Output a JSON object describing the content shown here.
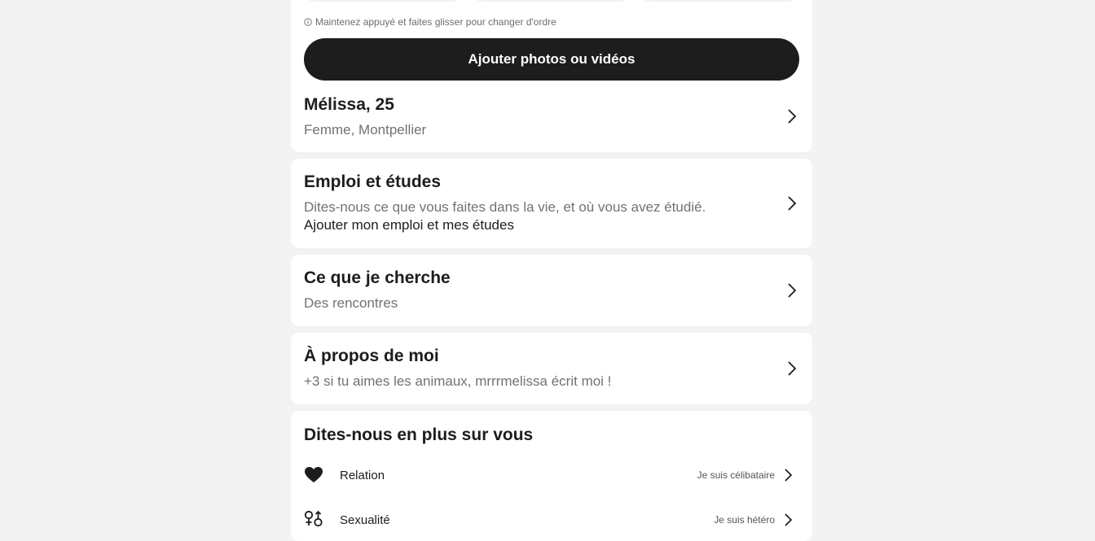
{
  "photos": {
    "hint": "Maintenez appuyé et faites glisser pour changer d'ordre",
    "add_button": "Ajouter photos ou vidéos"
  },
  "identity": {
    "name_age": "Mélissa, 25",
    "details": "Femme, Montpellier"
  },
  "sections": {
    "job": {
      "title": "Emploi et études",
      "description": "Dites-nous ce que vous faites dans la vie, et où vous avez étudié.",
      "action": "Ajouter mon emploi et mes études"
    },
    "looking_for": {
      "title": "Ce que je cherche",
      "value": "Des rencontres"
    },
    "about": {
      "title": "À propos de moi",
      "value": "+3 si tu aimes les animaux, mrrrmelissa écrit moi !"
    },
    "more": {
      "title": "Dites-nous en plus sur vous",
      "items": [
        {
          "label": "Relation",
          "value": "Je suis célibataire",
          "icon": "heart-icon"
        },
        {
          "label": "Sexualité",
          "value": "Je suis hétéro",
          "icon": "gender-symbols-icon"
        }
      ]
    }
  },
  "colors": {
    "background": "#f3f3f3",
    "card": "#ffffff",
    "primary": "#1d1d1d",
    "muted": "#727272"
  }
}
